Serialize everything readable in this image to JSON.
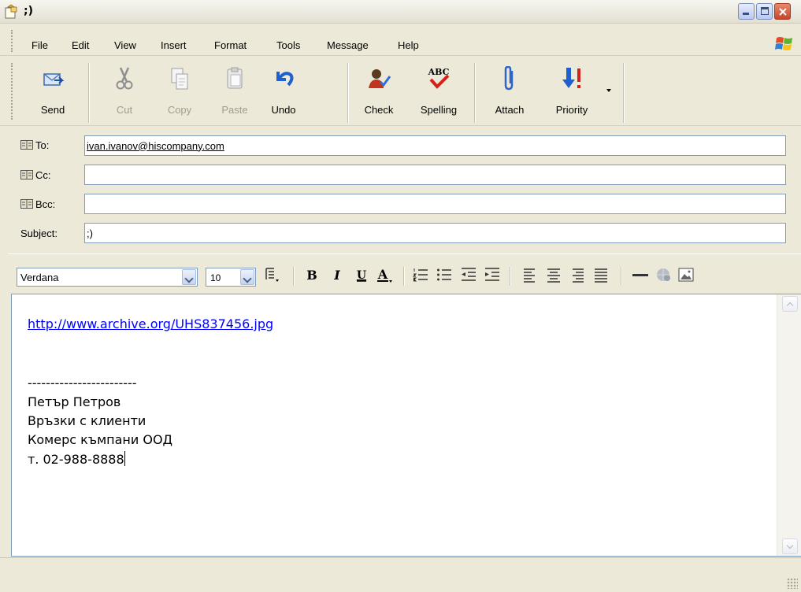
{
  "window": {
    "title": ";)"
  },
  "menu": [
    "File",
    "Edit",
    "View",
    "Insert",
    "Format",
    "Tools",
    "Message",
    "Help"
  ],
  "toolbar": {
    "send": "Send",
    "cut": "Cut",
    "copy": "Copy",
    "paste": "Paste",
    "undo": "Undo",
    "check": "Check",
    "spelling": "Spelling",
    "attach": "Attach",
    "priority": "Priority",
    "spelling_icon_text": "ABC"
  },
  "headers": {
    "to_label": "To:",
    "cc_label": "Cc:",
    "bcc_label": "Bcc:",
    "subject_label": "Subject:",
    "to_value": "ivan.ivanov@hiscompany.com",
    "cc_value": "",
    "bcc_value": "",
    "subject_value": ";)"
  },
  "format": {
    "font": "Verdana",
    "size": "10",
    "bold": "B",
    "italic": "I",
    "underline": "U",
    "font_color": "A"
  },
  "message": {
    "link": "http://www.archive.org/UHS837456.jpg",
    "separator": "------------------------",
    "sig_name": "Петър Петров",
    "sig_role": "Връзки с клиенти",
    "sig_company": "Комерс къмпани ООД",
    "sig_phone": "т. 02-988-8888"
  },
  "colors": {
    "link": "#0000ff",
    "priority_arrow": "#1f5fd0",
    "priority_mark": "#d4201a",
    "close_button": "#c6452b"
  }
}
